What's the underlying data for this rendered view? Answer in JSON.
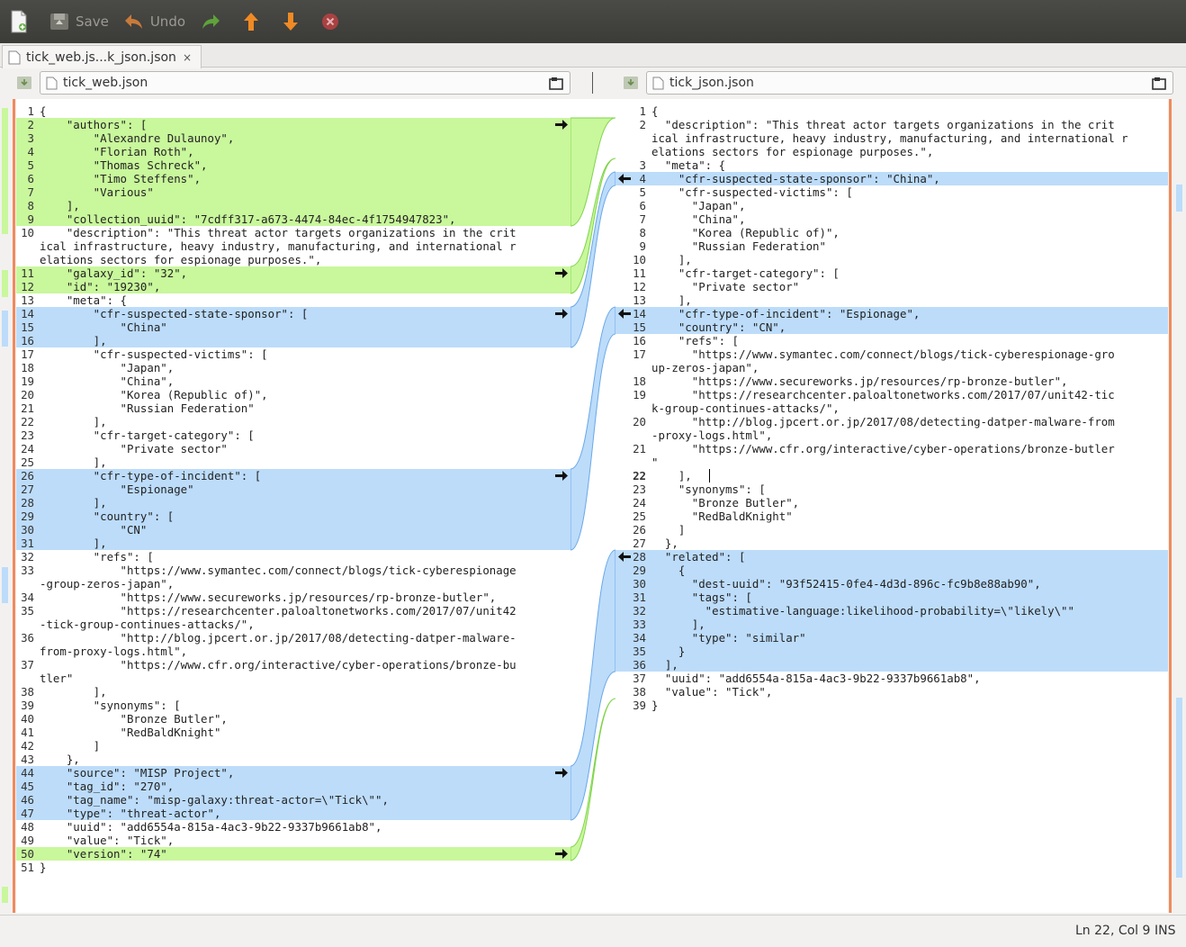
{
  "toolbar": {
    "new_icon": "new-file-icon",
    "save_label": "Save",
    "undo_label": "Undo",
    "redo_icon": "redo-icon",
    "up_icon": "previous-change-icon",
    "down_icon": "next-change-icon",
    "stop_icon": "stop-icon"
  },
  "tab": {
    "label": "tick_web.js...k_json.json",
    "close": "×"
  },
  "left_file": {
    "name": "tick_web.json"
  },
  "right_file": {
    "name": "tick_json.json"
  },
  "status": {
    "position": "Ln 22, Col 9",
    "mode": "INS"
  },
  "colors": {
    "inserted": "#c9f79c",
    "changed": "#bcdcfa",
    "highlight": "#8ebff1",
    "gutter": "#f08a5d"
  },
  "left_lines": [
    {
      "n": "1",
      "t": "{",
      "k": ""
    },
    {
      "n": "2",
      "t": "    \"authors\": [",
      "k": "ins"
    },
    {
      "n": "3",
      "t": "        \"Alexandre Dulaunoy\",",
      "k": "ins"
    },
    {
      "n": "4",
      "t": "        \"Florian Roth\",",
      "k": "ins"
    },
    {
      "n": "5",
      "t": "        \"Thomas Schreck\",",
      "k": "ins"
    },
    {
      "n": "6",
      "t": "        \"Timo Steffens\",",
      "k": "ins"
    },
    {
      "n": "7",
      "t": "        \"Various\"",
      "k": "ins"
    },
    {
      "n": "8",
      "t": "    ],",
      "k": "ins"
    },
    {
      "n": "9",
      "t": "    \"collection_uuid\": \"7cdff317-a673-4474-84ec-4f1754947823\",",
      "k": "ins"
    },
    {
      "n": "10",
      "t": "    \"description\": \"This threat actor targets organizations in the crit",
      "k": ""
    },
    {
      "n": "",
      "t": "ical infrastructure, heavy industry, manufacturing, and international r",
      "k": ""
    },
    {
      "n": "",
      "t": "elations sectors for espionage purposes.\",",
      "k": ""
    },
    {
      "n": "11",
      "t": "    \"galaxy_id\": \"32\",",
      "k": "ins"
    },
    {
      "n": "12",
      "t": "    \"id\": \"19230\",",
      "k": "ins"
    },
    {
      "n": "13",
      "t": "    \"meta\": {",
      "k": ""
    },
    {
      "n": "14",
      "t": "        \"cfr-suspected-state-sponsor\": [",
      "k": "chg"
    },
    {
      "n": "15",
      "t": "            \"China\"",
      "k": "chg"
    },
    {
      "n": "16",
      "t": "        ],",
      "k": "chg"
    },
    {
      "n": "17",
      "t": "        \"cfr-suspected-victims\": [",
      "k": ""
    },
    {
      "n": "18",
      "t": "            \"Japan\",",
      "k": ""
    },
    {
      "n": "19",
      "t": "            \"China\",",
      "k": ""
    },
    {
      "n": "20",
      "t": "            \"Korea (Republic of)\",",
      "k": ""
    },
    {
      "n": "21",
      "t": "            \"Russian Federation\"",
      "k": ""
    },
    {
      "n": "22",
      "t": "        ],",
      "k": ""
    },
    {
      "n": "23",
      "t": "        \"cfr-target-category\": [",
      "k": ""
    },
    {
      "n": "24",
      "t": "            \"Private sector\"",
      "k": ""
    },
    {
      "n": "25",
      "t": "        ],",
      "k": ""
    },
    {
      "n": "26",
      "t": "        \"cfr-type-of-incident\": [",
      "k": "chg"
    },
    {
      "n": "27",
      "t": "            \"Espionage\"",
      "k": "chg"
    },
    {
      "n": "28",
      "t": "        ],",
      "k": "chg"
    },
    {
      "n": "29",
      "t": "        \"country\": [",
      "k": "chg"
    },
    {
      "n": "30",
      "t": "            \"CN\"",
      "k": "chg"
    },
    {
      "n": "31",
      "t": "        ],",
      "k": "chg"
    },
    {
      "n": "32",
      "t": "        \"refs\": [",
      "k": ""
    },
    {
      "n": "33",
      "t": "            \"https://www.symantec.com/connect/blogs/tick-cyberespionage",
      "k": ""
    },
    {
      "n": "",
      "t": "-group-zeros-japan\",",
      "k": ""
    },
    {
      "n": "34",
      "t": "            \"https://www.secureworks.jp/resources/rp-bronze-butler\",",
      "k": ""
    },
    {
      "n": "35",
      "t": "            \"https://researchcenter.paloaltonetworks.com/2017/07/unit42",
      "k": ""
    },
    {
      "n": "",
      "t": "-tick-group-continues-attacks/\",",
      "k": ""
    },
    {
      "n": "36",
      "t": "            \"http://blog.jpcert.or.jp/2017/08/detecting-datper-malware-",
      "k": ""
    },
    {
      "n": "",
      "t": "from-proxy-logs.html\",",
      "k": ""
    },
    {
      "n": "37",
      "t": "            \"https://www.cfr.org/interactive/cyber-operations/bronze-bu",
      "k": ""
    },
    {
      "n": "",
      "t": "tler\"",
      "k": ""
    },
    {
      "n": "38",
      "t": "        ],",
      "k": ""
    },
    {
      "n": "39",
      "t": "        \"synonyms\": [",
      "k": ""
    },
    {
      "n": "40",
      "t": "            \"Bronze Butler\",",
      "k": ""
    },
    {
      "n": "41",
      "t": "            \"RedBaldKnight\"",
      "k": ""
    },
    {
      "n": "42",
      "t": "        ]",
      "k": ""
    },
    {
      "n": "43",
      "t": "    },",
      "k": ""
    },
    {
      "n": "44",
      "t": "    \"source\": \"MISP Project\",",
      "k": "chg"
    },
    {
      "n": "45",
      "t": "    \"tag_id\": \"270\",",
      "k": "chg"
    },
    {
      "n": "46",
      "t": "    \"tag_name\": \"misp-galaxy:threat-actor=\\\"Tick\\\"\",",
      "k": "chg"
    },
    {
      "n": "47",
      "t": "    \"type\": \"threat-actor\",",
      "k": "chg"
    },
    {
      "n": "48",
      "t": "    \"uuid\": \"add6554a-815a-4ac3-9b22-9337b9661ab8\",",
      "k": ""
    },
    {
      "n": "49",
      "t": "    \"value\": \"Tick\",",
      "k": ""
    },
    {
      "n": "50",
      "t": "    \"version\": \"74\"",
      "k": "ins"
    },
    {
      "n": "51",
      "t": "}",
      "k": ""
    }
  ],
  "right_lines": [
    {
      "n": "1",
      "t": "{",
      "k": ""
    },
    {
      "n": "2",
      "t": "  \"description\": \"This threat actor targets organizations in the crit",
      "k": ""
    },
    {
      "n": "",
      "t": "ical infrastructure, heavy industry, manufacturing, and international r",
      "k": ""
    },
    {
      "n": "",
      "t": "elations sectors for espionage purposes.\",",
      "k": ""
    },
    {
      "n": "3",
      "t": "  \"meta\": {",
      "k": ""
    },
    {
      "n": "4",
      "t": "    \"cfr-suspected-state-sponsor\": \"China\",",
      "k": "chg"
    },
    {
      "n": "5",
      "t": "    \"cfr-suspected-victims\": [",
      "k": ""
    },
    {
      "n": "6",
      "t": "      \"Japan\",",
      "k": ""
    },
    {
      "n": "7",
      "t": "      \"China\",",
      "k": ""
    },
    {
      "n": "8",
      "t": "      \"Korea (Republic of)\",",
      "k": ""
    },
    {
      "n": "9",
      "t": "      \"Russian Federation\"",
      "k": ""
    },
    {
      "n": "10",
      "t": "    ],",
      "k": ""
    },
    {
      "n": "11",
      "t": "    \"cfr-target-category\": [",
      "k": ""
    },
    {
      "n": "12",
      "t": "      \"Private sector\"",
      "k": ""
    },
    {
      "n": "13",
      "t": "    ],",
      "k": ""
    },
    {
      "n": "14",
      "t": "    \"cfr-type-of-incident\": \"Espionage\",",
      "k": "chg"
    },
    {
      "n": "15",
      "t": "    \"country\": \"CN\",",
      "k": "chg"
    },
    {
      "n": "16",
      "t": "    \"refs\": [",
      "k": ""
    },
    {
      "n": "17",
      "t": "      \"https://www.symantec.com/connect/blogs/tick-cyberespionage-gro",
      "k": ""
    },
    {
      "n": "",
      "t": "up-zeros-japan\",",
      "k": ""
    },
    {
      "n": "18",
      "t": "      \"https://www.secureworks.jp/resources/rp-bronze-butler\",",
      "k": ""
    },
    {
      "n": "19",
      "t": "      \"https://researchcenter.paloaltonetworks.com/2017/07/unit42-tic",
      "k": ""
    },
    {
      "n": "",
      "t": "k-group-continues-attacks/\",",
      "k": ""
    },
    {
      "n": "20",
      "t": "      \"http://blog.jpcert.or.jp/2017/08/detecting-datper-malware-from",
      "k": ""
    },
    {
      "n": "",
      "t": "-proxy-logs.html\",",
      "k": ""
    },
    {
      "n": "21",
      "t": "      \"https://www.cfr.org/interactive/cyber-operations/bronze-butler",
      "k": ""
    },
    {
      "n": "",
      "t": "\"",
      "k": ""
    },
    {
      "n": "22",
      "t": "    ],",
      "k": "cur"
    },
    {
      "n": "23",
      "t": "    \"synonyms\": [",
      "k": ""
    },
    {
      "n": "24",
      "t": "      \"Bronze Butler\",",
      "k": ""
    },
    {
      "n": "25",
      "t": "      \"RedBaldKnight\"",
      "k": ""
    },
    {
      "n": "26",
      "t": "    ]",
      "k": ""
    },
    {
      "n": "27",
      "t": "  },",
      "k": ""
    },
    {
      "n": "28",
      "t": "  \"related\": [",
      "k": "chg"
    },
    {
      "n": "29",
      "t": "    {",
      "k": "chg"
    },
    {
      "n": "30",
      "t": "      \"dest-uuid\": \"93f52415-0fe4-4d3d-896c-fc9b8e88ab90\",",
      "k": "chg"
    },
    {
      "n": "31",
      "t": "      \"tags\": [",
      "k": "chg"
    },
    {
      "n": "32",
      "t": "        \"estimative-language:likelihood-probability=\\\"likely\\\"\"",
      "k": "chg"
    },
    {
      "n": "33",
      "t": "      ],",
      "k": "chg"
    },
    {
      "n": "34",
      "t": "      \"type\": \"similar\"",
      "k": "chg"
    },
    {
      "n": "35",
      "t": "    }",
      "k": "chg"
    },
    {
      "n": "36",
      "t": "  ],",
      "k": "chg"
    },
    {
      "n": "37",
      "t": "  \"uuid\": \"add6554a-815a-4ac3-9b22-9337b9661ab8\",",
      "k": ""
    },
    {
      "n": "38",
      "t": "  \"value\": \"Tick\",",
      "k": ""
    },
    {
      "n": "39",
      "t": "}",
      "k": ""
    }
  ]
}
